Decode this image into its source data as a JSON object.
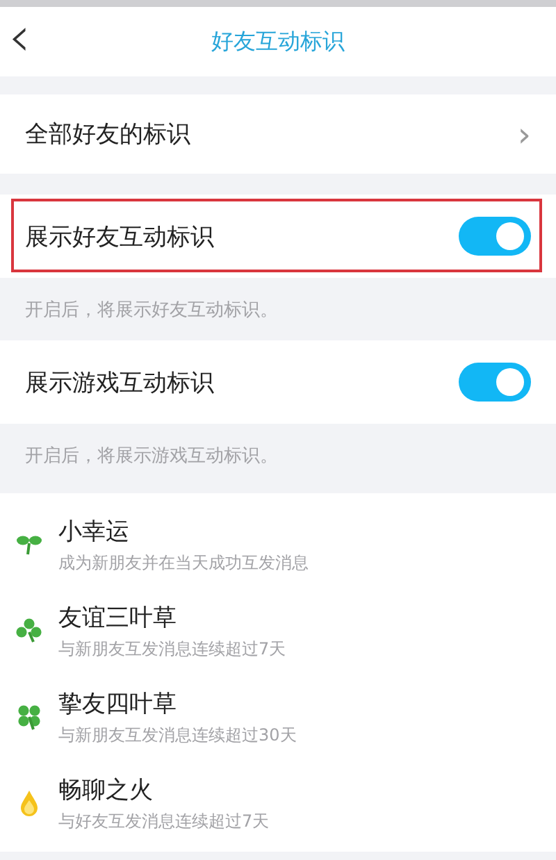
{
  "header": {
    "back_icon": "‹",
    "title": "好友互动标识"
  },
  "nav_row": {
    "label": "全部好友的标识",
    "chevron": "›"
  },
  "toggles": [
    {
      "label": "展示好友互动标识",
      "on": true,
      "highlighted": true,
      "hint": "开启后，将展示好友互动标识。"
    },
    {
      "label": "展示游戏互动标识",
      "on": true,
      "highlighted": false,
      "hint": "开启后，将展示游戏互动标识。"
    }
  ],
  "badges": [
    {
      "kind": "sprout",
      "name": "小幸运",
      "description": "成为新朋友并在当天成功互发消息"
    },
    {
      "kind": "clover3",
      "name": "友谊三叶草",
      "description": "与新朋友互发消息连续超过7天"
    },
    {
      "kind": "clover4",
      "name": "挚友四叶草",
      "description": "与新朋友互发消息连续超过30天"
    },
    {
      "kind": "flame",
      "name": "畅聊之火",
      "description": "与好友互发消息连续超过7天"
    }
  ]
}
